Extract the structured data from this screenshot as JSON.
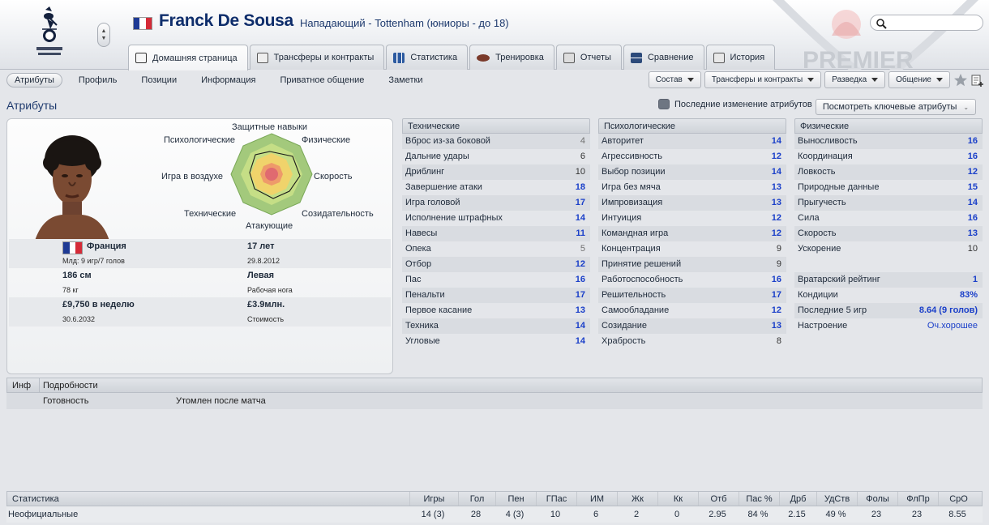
{
  "header": {
    "player_name": "Franck De Sousa",
    "player_role": "Нападающий - Tottenham (юниоры - до 18)",
    "search_placeholder": "",
    "watermark_text": "PREMIER"
  },
  "tabs": [
    {
      "label": "Домашняя страница",
      "icon": "home-page-icon",
      "active": true
    },
    {
      "label": "Трансферы и контракты",
      "icon": "document-icon",
      "active": false
    },
    {
      "label": "Статистика",
      "icon": "bar-chart-icon",
      "active": false
    },
    {
      "label": "Тренировка",
      "icon": "football-icon",
      "active": false
    },
    {
      "label": "Отчеты",
      "icon": "report-icon",
      "active": false
    },
    {
      "label": "Сравнение",
      "icon": "compare-icon",
      "active": false
    },
    {
      "label": "История",
      "icon": "history-icon",
      "active": false
    }
  ],
  "subnav": [
    "Атрибуты",
    "Профиль",
    "Позиции",
    "Информация",
    "Приватное общение",
    "Заметки"
  ],
  "right_menus": [
    "Состав",
    "Трансферы и контракты",
    "Разведка",
    "Общение"
  ],
  "page_title": "Атрибуты",
  "legend_text": "Последние изменение атрибутов",
  "key_attrs_button": "Посмотреть ключевые атрибуты",
  "radar_labels": {
    "top": "Защитные навыки",
    "top_left": "Психологические",
    "top_right": "Физические",
    "left": "Игра в воздухе",
    "right": "Скорость",
    "bottom_left": "Технические",
    "bottom_right": "Созидательность",
    "bottom": "Атакующие"
  },
  "player_info": {
    "nation": "Франция",
    "youth_caps": "Млд: 9 игр/7 голов",
    "age": "17 лет",
    "dob": "29.8.2012",
    "height": "186 см",
    "weight": "78 кг",
    "foot": "Левая",
    "foot_label": "Рабочая нога",
    "wage": "£9,750 в неделю",
    "contract_end": "30.6.2032",
    "value": "£3.9млн.",
    "value_label": "Стоимость"
  },
  "technical": {
    "header": "Технические",
    "rows": [
      {
        "name": "Вброс из-за боковой",
        "value": "4"
      },
      {
        "name": "Дальние удары",
        "value": "6"
      },
      {
        "name": "Дриблинг",
        "value": "10"
      },
      {
        "name": "Завершение атаки",
        "value": "18"
      },
      {
        "name": "Игра головой",
        "value": "17"
      },
      {
        "name": "Исполнение штрафных",
        "value": "14"
      },
      {
        "name": "Навесы",
        "value": "11"
      },
      {
        "name": "Опека",
        "value": "5"
      },
      {
        "name": "Отбор",
        "value": "12"
      },
      {
        "name": "Пас",
        "value": "16"
      },
      {
        "name": "Пенальти",
        "value": "17"
      },
      {
        "name": "Первое касание",
        "value": "13"
      },
      {
        "name": "Техника",
        "value": "14"
      },
      {
        "name": "Угловые",
        "value": "14"
      }
    ]
  },
  "mental": {
    "header": "Психологические",
    "rows": [
      {
        "name": "Авторитет",
        "value": "14"
      },
      {
        "name": "Агрессивность",
        "value": "12"
      },
      {
        "name": "Выбор позиции",
        "value": "14"
      },
      {
        "name": "Игра без мяча",
        "value": "13"
      },
      {
        "name": "Импровизация",
        "value": "13"
      },
      {
        "name": "Интуиция",
        "value": "12"
      },
      {
        "name": "Командная игра",
        "value": "12"
      },
      {
        "name": "Концентрация",
        "value": "9"
      },
      {
        "name": "Принятие решений",
        "value": "9"
      },
      {
        "name": "Работоспособность",
        "value": "16"
      },
      {
        "name": "Решительность",
        "value": "17"
      },
      {
        "name": "Самообладание",
        "value": "12"
      },
      {
        "name": "Созидание",
        "value": "13"
      },
      {
        "name": "Храбрость",
        "value": "8"
      }
    ]
  },
  "physical": {
    "header": "Физические",
    "rows": [
      {
        "name": "Выносливость",
        "value": "16"
      },
      {
        "name": "Координация",
        "value": "16"
      },
      {
        "name": "Ловкость",
        "value": "12"
      },
      {
        "name": "Природные данные",
        "value": "15"
      },
      {
        "name": "Прыгучесть",
        "value": "14"
      },
      {
        "name": "Сила",
        "value": "16"
      },
      {
        "name": "Скорость",
        "value": "13"
      },
      {
        "name": "Ускорение",
        "value": "10"
      }
    ],
    "extra": [
      {
        "name": "Вратарский рейтинг",
        "value": "1"
      },
      {
        "name": "Кондиции",
        "value": "83%"
      },
      {
        "name": "Последние 5 игр",
        "value": "8.64 (9 голов)"
      },
      {
        "name": "Настроение",
        "value": "Оч.хорошее"
      }
    ]
  },
  "details": {
    "headers": [
      "Инф",
      "Подробности"
    ],
    "row": {
      "label": "Готовность",
      "value": "Утомлен после матча"
    }
  },
  "stats": {
    "header_label": "Статистика",
    "columns": [
      "Игры",
      "Гол",
      "Пен",
      "ГПас",
      "ИМ",
      "Жк",
      "Кк",
      "Отб",
      "Пас %",
      "Дрб",
      "УдСтв",
      "Фолы",
      "ФлПр",
      "СрО"
    ],
    "row_label": "Неофициальные",
    "row_values": [
      "14 (3)",
      "28",
      "4 (3)",
      "10",
      "6",
      "2",
      "0",
      "2.95",
      "84 %",
      "2.15",
      "49 %",
      "23",
      "23",
      "8.55"
    ]
  },
  "colors": {
    "title_blue": "#0e2d6b",
    "value_blue": "#1a3fc9",
    "panel_bg": "#e4e6ea"
  }
}
